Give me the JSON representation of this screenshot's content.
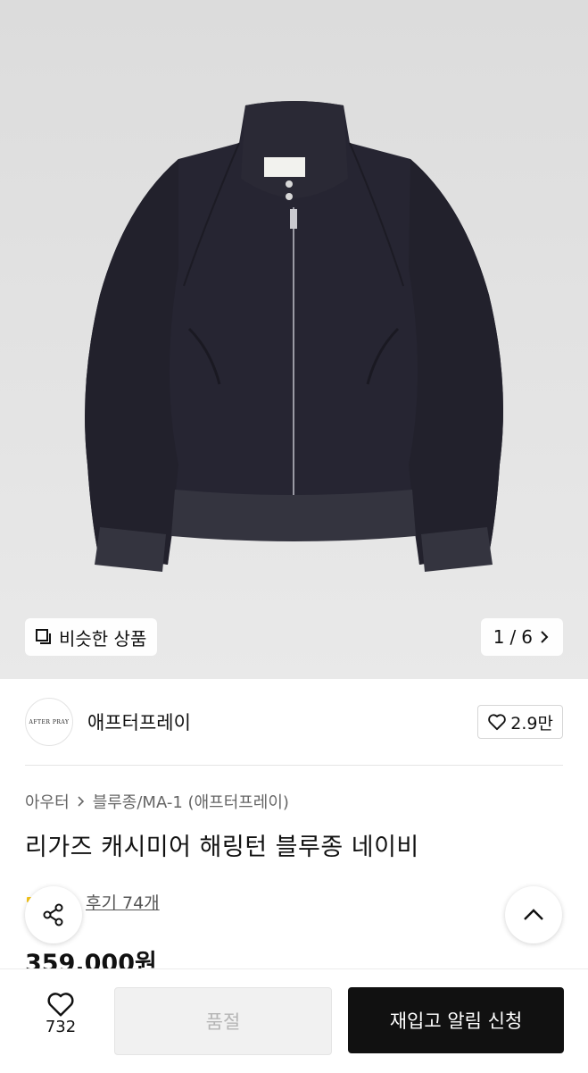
{
  "gallery": {
    "similar_label": "비슷한 상품",
    "current_page": "1",
    "total_pages": "6",
    "pager_separator": "/"
  },
  "brand": {
    "logo_text": "AFTER PRAY",
    "name": "애프터프레이",
    "likes": "2.9만"
  },
  "breadcrumb": {
    "level1": "아우터",
    "level2": "블루종/MA-1 (애프터프레이)"
  },
  "product": {
    "title": "리가즈 캐시미어 해링턴 블루종 네이비",
    "reviews": "후기 74개",
    "price": "359,000원"
  },
  "bottom_bar": {
    "wish_count": "732",
    "soldout_label": "품절",
    "restock_label": "재입고 알림 신청"
  },
  "icons": {
    "share": "share-icon",
    "scroll_top": "chevron-up-icon",
    "heart": "heart-icon"
  },
  "colors": {
    "jacket": "#262532",
    "primary_button": "#111111",
    "disabled_button": "#f1f1f1"
  }
}
